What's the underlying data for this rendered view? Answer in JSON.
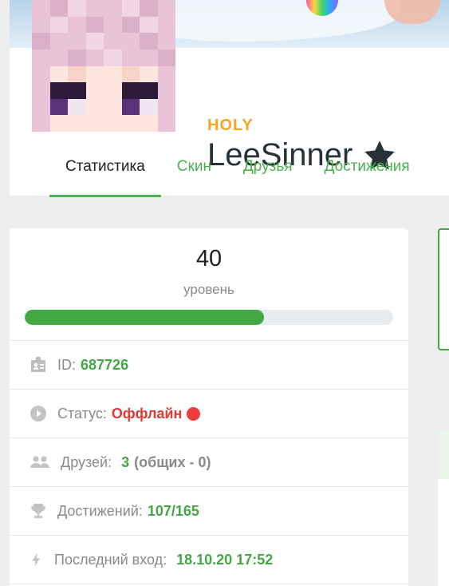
{
  "profile": {
    "rank": "HOLY",
    "nickname": "LeeSinner"
  },
  "tabs": [
    {
      "label": "Статистика",
      "active": true
    },
    {
      "label": "Скин",
      "active": false
    },
    {
      "label": "Друзья",
      "active": false
    },
    {
      "label": "Достижения",
      "active": false
    }
  ],
  "level": {
    "value": "40",
    "label": "уровень",
    "progress_fraction": 0.65
  },
  "stats": {
    "id_label": "ID:",
    "id_value": "687726",
    "status_label": "Статус:",
    "status_value": "Оффлайн",
    "friends_label": "Друзей:",
    "friends_value": "3",
    "friends_common": "(общих - 0)",
    "achievements_label": "Достижений:",
    "achievements_value": "107/165",
    "last_login_label": "Последний вход:",
    "last_login_value": "18.10.20 17:52"
  },
  "colors": {
    "accent": "#43a844",
    "rank": "#f5a623",
    "offline": "#f03c3c"
  },
  "icons": [
    "star-icon",
    "id-card-icon",
    "play-circle-icon",
    "users-icon",
    "trophy-icon",
    "bolt-icon"
  ]
}
